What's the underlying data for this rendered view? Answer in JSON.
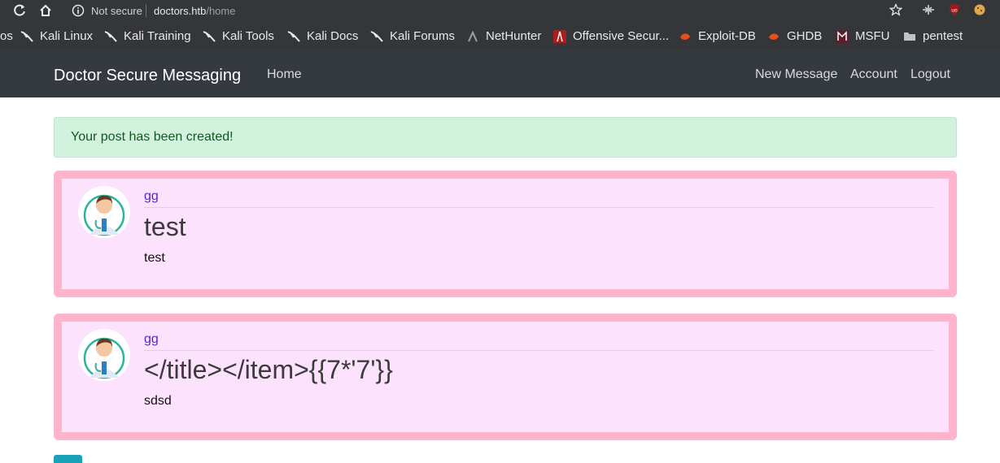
{
  "browser": {
    "security_label": "Not secure",
    "url_host": "doctors.htb",
    "url_path": "/home"
  },
  "bookmarks": [
    {
      "label": "os",
      "icon": "truncated-bookmark-icon"
    },
    {
      "label": "Kali Linux",
      "icon": "kali-dragon-icon"
    },
    {
      "label": "Kali Training",
      "icon": "kali-dragon-icon"
    },
    {
      "label": "Kali Tools",
      "icon": "kali-dragon-icon"
    },
    {
      "label": "Kali Docs",
      "icon": "kali-dragon-icon"
    },
    {
      "label": "Kali Forums",
      "icon": "kali-dragon-icon"
    },
    {
      "label": "NetHunter",
      "icon": "nethunter-icon"
    },
    {
      "label": "Offensive Secur...",
      "icon": "offsec-icon"
    },
    {
      "label": "Exploit-DB",
      "icon": "exploitdb-icon"
    },
    {
      "label": "GHDB",
      "icon": "ghdb-icon"
    },
    {
      "label": "MSFU",
      "icon": "msfu-icon"
    },
    {
      "label": "pentest",
      "icon": "folder-icon"
    }
  ],
  "navbar": {
    "brand": "Doctor Secure Messaging",
    "home": "Home",
    "new_message": "New Message",
    "account": "Account",
    "logout": "Logout"
  },
  "alert": {
    "message": "Your post has been created!"
  },
  "posts": [
    {
      "author": "gg",
      "title": "test",
      "body": "test"
    },
    {
      "author": "gg",
      "title": "</title></item>{{7*'7'}}",
      "body": "sdsd"
    }
  ],
  "colors": {
    "navbar": "#343a40",
    "alert_bg": "#d1f2dd",
    "post_border": "#ffb3cd",
    "post_bg": "#fde2fe",
    "author_link": "#5a1ecb"
  }
}
